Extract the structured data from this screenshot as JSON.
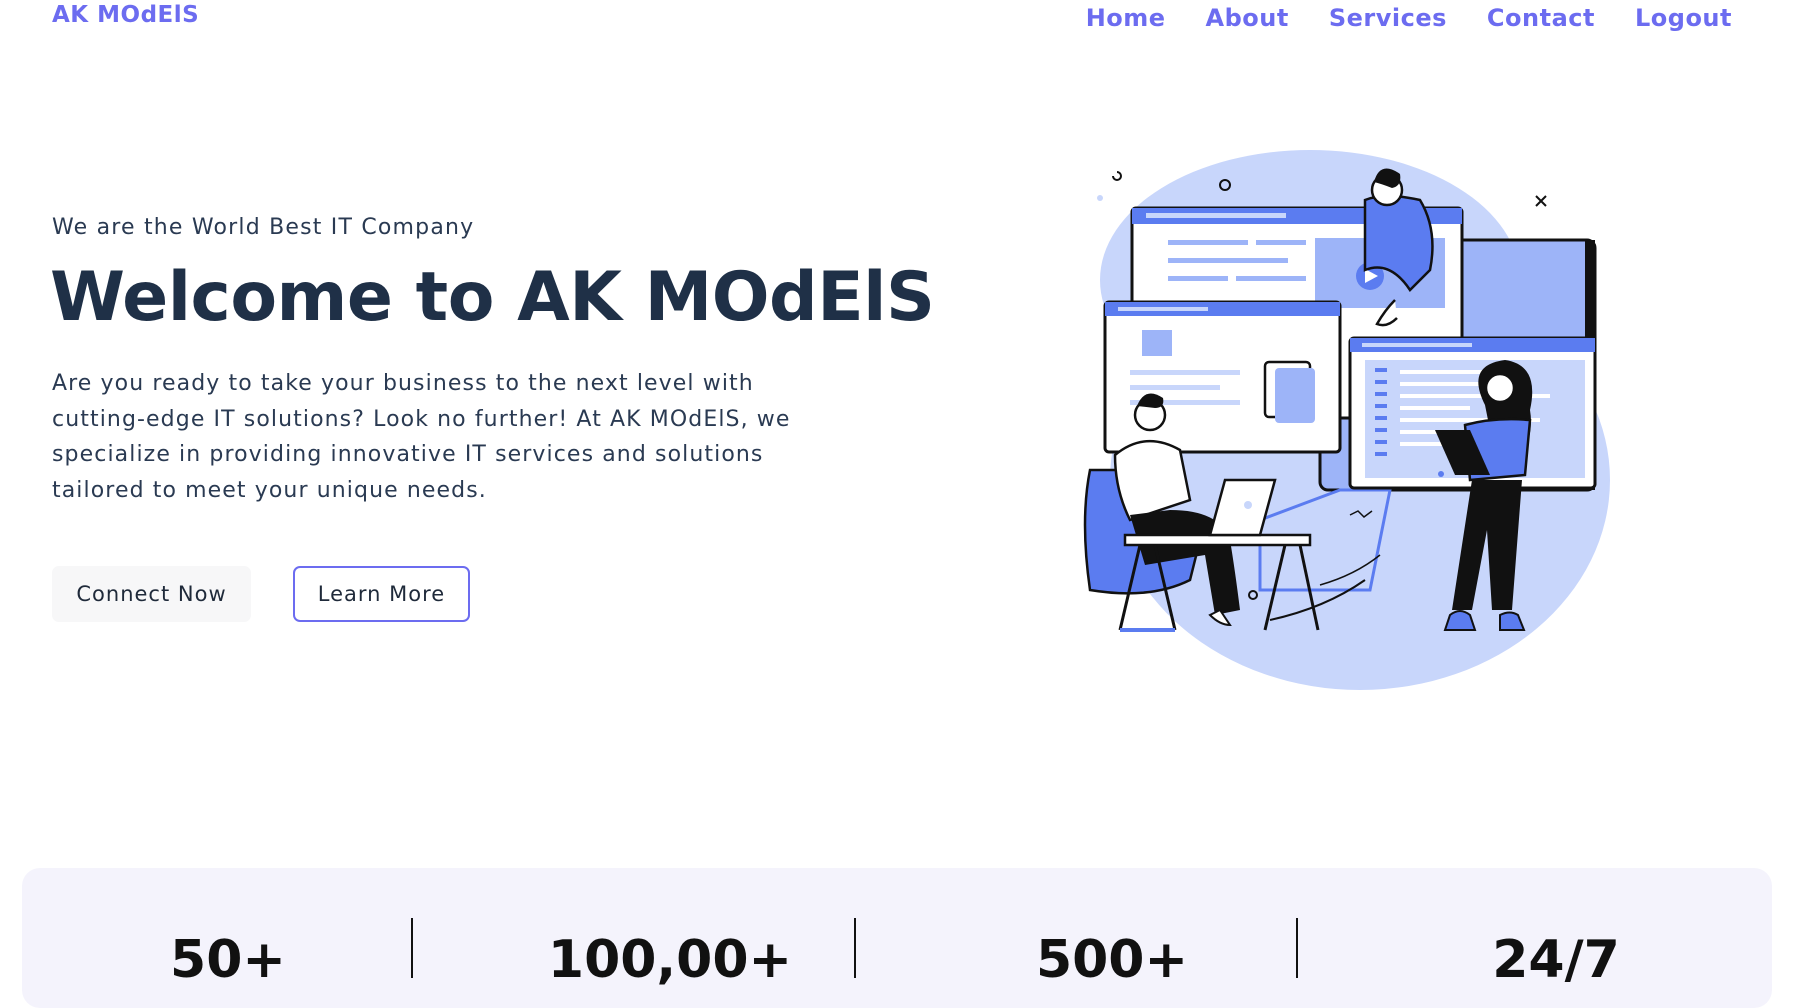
{
  "header": {
    "brand": "AK MOdElS",
    "nav": [
      {
        "label": "Home"
      },
      {
        "label": "About"
      },
      {
        "label": "Services"
      },
      {
        "label": "Contact"
      },
      {
        "label": "Logout"
      }
    ]
  },
  "hero": {
    "eyebrow": "We are the World Best IT Company",
    "title": "Welcome to AK MOdElS",
    "description": "Are you ready to take your business to the next level with cutting-edge IT solutions? Look no further! At AK MOdElS, we specialize in providing innovative IT services and solutions tailored to meet your unique needs.",
    "connect_label": "Connect Now",
    "learn_label": "Learn More"
  },
  "stats": [
    {
      "value": "50+"
    },
    {
      "value": "100,00+"
    },
    {
      "value": "500+"
    },
    {
      "value": "24/7"
    }
  ],
  "colors": {
    "accent": "#6c6cf0",
    "heading": "#1f3047",
    "illustration_blue": "#5b7cf0",
    "illustration_light": "#c8d6fb",
    "stats_bg": "#f4f3fc"
  }
}
